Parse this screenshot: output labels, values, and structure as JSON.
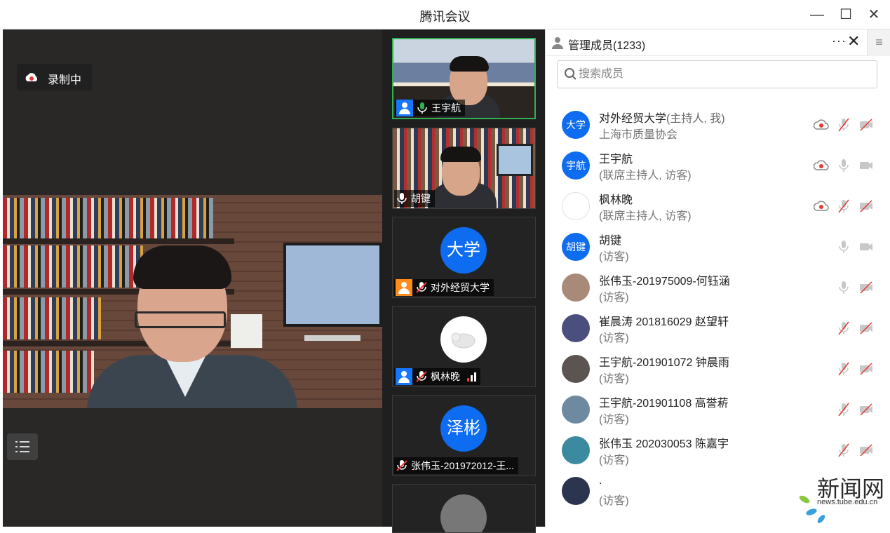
{
  "window": {
    "title": "腾讯会议",
    "minimize": "—",
    "maximize": "☐",
    "close": "✕"
  },
  "main_video": {
    "recording_label": "录制中"
  },
  "thumbnails": [
    {
      "name": "王宇航",
      "type": "video",
      "active": true,
      "role_icon": "user-icon",
      "mic": "on"
    },
    {
      "name": "胡键",
      "type": "video",
      "active": false,
      "mic": "on"
    },
    {
      "name": "对外经贸大学",
      "type": "avatar",
      "avatar_text": "大学",
      "role_icon": "user-icon-orange",
      "mic": "muted"
    },
    {
      "name": "枫林晚",
      "type": "avatar-image",
      "role_icon": "user-icon",
      "mic": "muted",
      "signal": "bars"
    },
    {
      "name": "张伟玉-201972012-王...",
      "type": "avatar",
      "avatar_text": "泽彬",
      "mic": "muted"
    },
    {
      "name": "",
      "type": "avatar-image",
      "mic": "unknown"
    }
  ],
  "panel": {
    "title": "管理成员(1233)",
    "more": "···",
    "close": "✕",
    "menu": "≡",
    "search_placeholder": "搜索成员",
    "members": [
      {
        "avatar_text": "大学",
        "avatar_color": "#0e6cf0",
        "name": "对外经贸大学",
        "tag": "(主持人, 我)",
        "sub": "上海市质量协会",
        "rec": true,
        "mic": "muted",
        "cam": "off"
      },
      {
        "avatar_text": "宇航",
        "avatar_color": "#0e6cf0",
        "name": "王宇航",
        "tag": "",
        "sub": "(联席主持人, 访客)",
        "rec": true,
        "mic": "on",
        "cam": "on"
      },
      {
        "avatar_text": "",
        "avatar_color": "#ffffff",
        "name": "枫林晚",
        "tag": "",
        "sub": "(联席主持人, 访客)",
        "rec": true,
        "mic": "muted",
        "cam": "off"
      },
      {
        "avatar_text": "胡键",
        "avatar_color": "#0e6cf0",
        "name": "胡键",
        "tag": "",
        "sub": "(访客)",
        "rec": false,
        "mic": "on",
        "cam": "on"
      },
      {
        "avatar_text": "",
        "avatar_color": "#a98a78",
        "name": "张伟玉-201975009-何钰涵",
        "tag": "",
        "sub": "(访客)",
        "rec": false,
        "mic": "on",
        "cam": "off"
      },
      {
        "avatar_text": "",
        "avatar_color": "#4b4f7e",
        "name": " 崔晨涛 201816029 赵望轩",
        "tag": "",
        "sub": "(访客)",
        "rec": false,
        "mic": "muted",
        "cam": "off"
      },
      {
        "avatar_text": "",
        "avatar_color": "#5b5450",
        "name": " 王宇航-201901072 钟晨雨",
        "tag": "",
        "sub": "(访客)",
        "rec": false,
        "mic": "muted",
        "cam": "off"
      },
      {
        "avatar_text": "",
        "avatar_color": "#6d8aa0",
        "name": " 王宇航-201901108 高誉菥",
        "tag": "",
        "sub": "(访客)",
        "rec": false,
        "mic": "muted",
        "cam": "off"
      },
      {
        "avatar_text": "",
        "avatar_color": "#3c8aa0",
        "name": " 张伟玉 202030053 陈嘉宇",
        "tag": "",
        "sub": "(访客)",
        "rec": false,
        "mic": "muted",
        "cam": "off"
      },
      {
        "avatar_text": "",
        "avatar_color": "#2c3550",
        "name": ".",
        "tag": "",
        "sub": "(访客)",
        "rec": false,
        "mic": "none",
        "cam": "none"
      }
    ]
  },
  "watermark": {
    "big": "新闻网",
    "small": "news.tube.edu.cn"
  },
  "colors": {
    "accent_blue": "#0e6cf0",
    "active_green": "#2fb152",
    "rec_red": "#e53935",
    "muted_red": "#e53935"
  }
}
